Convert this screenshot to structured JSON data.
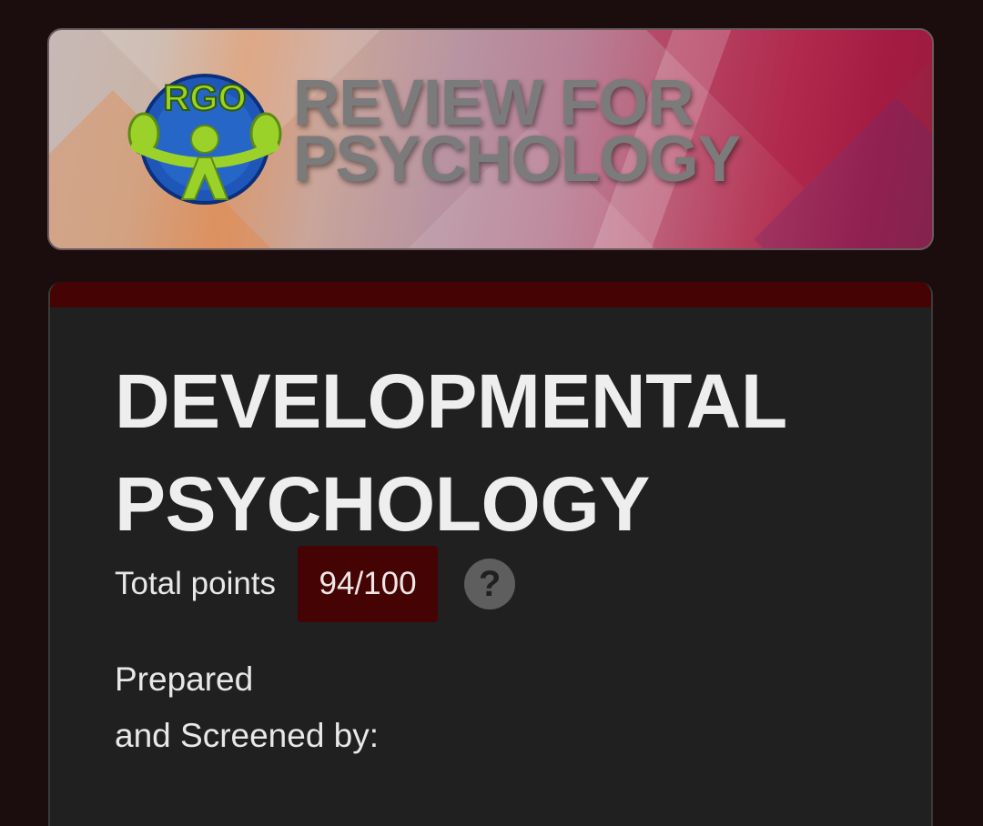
{
  "banner": {
    "logo_text": "RGO",
    "title_line1": "REVIEW FOR",
    "title_line2": "PSYCHOLOGY"
  },
  "form": {
    "title_line1": "DEVELOPMENTAL",
    "title_line2": "PSYCHOLOGY",
    "points_label": "Total points",
    "score": "94/100",
    "help_symbol": "?",
    "description_line1": "Prepared",
    "description_line2": "and Screened by:"
  },
  "colors": {
    "page_background": "#1b0c0d",
    "card_background": "#202020",
    "accent": "#450304",
    "help_icon": "#5e5e5e"
  },
  "icons": {
    "help": "question-circle-icon"
  }
}
